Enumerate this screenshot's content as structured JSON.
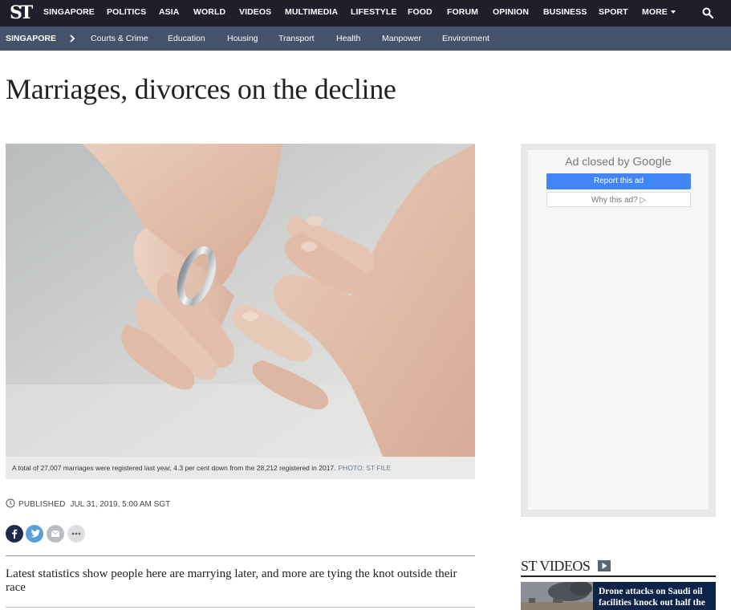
{
  "top_nav": {
    "logo": "ST",
    "items": [
      "SINGAPORE",
      "POLITICS",
      "ASIA",
      "WORLD",
      "VIDEOS",
      "MULTIMEDIA",
      "LIFESTYLE",
      "FOOD",
      "FORUM",
      "OPINION",
      "BUSINESS",
      "SPORT",
      "MORE"
    ],
    "active": "SINGAPORE",
    "search_icon": "search-icon"
  },
  "section_nav": {
    "section": "SINGAPORE",
    "items": [
      "Courts & Crime",
      "Education",
      "Housing",
      "Transport",
      "Health",
      "Manpower",
      "Environment"
    ]
  },
  "article": {
    "headline": "Marriages, divorces on the decline",
    "image_caption": "A total of 27,007 marriages were registered last year, 4.3 per cent down from the 28,212 registered in 2017.",
    "image_credit": "PHOTO: ST FILE",
    "published_label": "PUBLISHED",
    "published_date": "JUL 31, 2019, 5:00 AM SGT",
    "standfirst": "Latest statistics show people here are marrying later, and more are tying the knot outside their race"
  },
  "share": {
    "icons": [
      "facebook-icon",
      "twitter-icon",
      "email-icon",
      "more-icon"
    ]
  },
  "ad": {
    "closed_text": "Ad closed by",
    "brand": "Google",
    "report_label": "Report this ad",
    "why_label": "Why this ad?"
  },
  "videos": {
    "title": "ST VIDEOS",
    "first_title": "Drone attacks on Saudi oil facilities knock out half the"
  },
  "colors": {
    "top_nav_bg": "#1e1f2b",
    "section_nav_bg": "#45526b",
    "google_blue": "#4285f4",
    "video_card_bg": "#0b2447"
  }
}
